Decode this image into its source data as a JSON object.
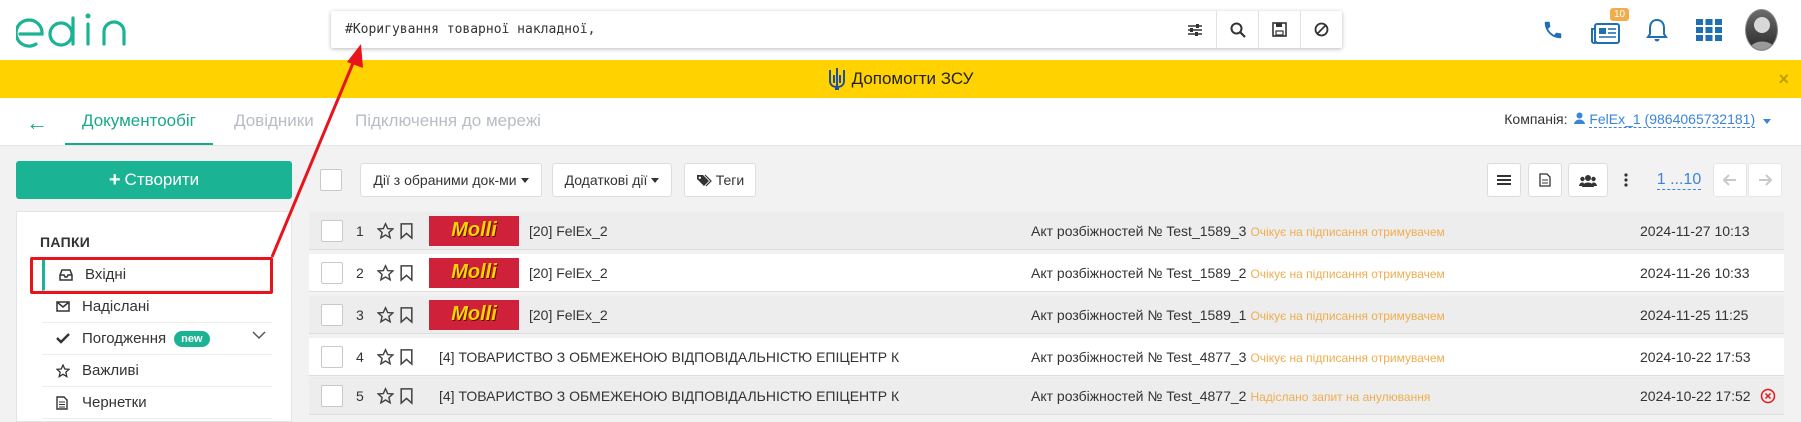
{
  "app": {
    "logo_text": "edin"
  },
  "search": {
    "value": "#Коригування товарної накладної,",
    "buttons": [
      "filter-sliders-icon",
      "search-icon",
      "save-icon",
      "clear-icon"
    ]
  },
  "top_icons": {
    "phone": "phone-icon",
    "news": "newspaper-icon",
    "news_badge": "10",
    "bell": "bell-icon",
    "apps": "apps-grid-icon"
  },
  "banner": {
    "text": "Допомогти ЗСУ",
    "close": "×"
  },
  "nav": {
    "back": "←",
    "tabs": [
      {
        "label": "Документообіг",
        "active": true
      },
      {
        "label": "Довідники",
        "active": false
      },
      {
        "label": "Підключення до мережі",
        "active": false
      }
    ],
    "company_label": "Компанія:",
    "company_value": "FelEx_1 (9864065732181)"
  },
  "sidebar": {
    "create_label": "Створити",
    "folders_title": "ПАПКИ",
    "folders": [
      {
        "label": "Вхідні",
        "icon": "inbox-icon",
        "active": true
      },
      {
        "label": "Надіслані",
        "icon": "envelope-icon"
      },
      {
        "label": "Погодження",
        "icon": "check-icon",
        "badge": "new"
      },
      {
        "label": "Важливі",
        "icon": "star-icon"
      },
      {
        "label": "Чернетки",
        "icon": "draft-icon"
      }
    ]
  },
  "toolbar": {
    "actions_label": "Дії з обраними док-ми",
    "extra_label": "Додаткові дії",
    "tags_label": "Теги",
    "pager": "1 ...10"
  },
  "rows": [
    {
      "num": "1",
      "logo": "Molli",
      "name": "[20] FelEx_2",
      "doc": "Акт розбіжностей № Test_1589_3",
      "status": "Очікує на підписання отримувачем",
      "date": "2024-11-27 10:13"
    },
    {
      "num": "2",
      "logo": "Molli",
      "name": "[20] FelEx_2",
      "doc": "Акт розбіжностей № Test_1589_2",
      "status": "Очікує на підписання отримувачем",
      "date": "2024-11-26 10:33"
    },
    {
      "num": "3",
      "logo": "Molli",
      "name": "[20] FelEx_2",
      "doc": "Акт розбіжностей № Test_1589_1",
      "status": "Очікує на підписання отримувачем",
      "date": "2024-11-25 11:25"
    },
    {
      "num": "4",
      "logo": "",
      "name": "[4] ТОВАРИСТВО З ОБМЕЖЕНОЮ ВІДПОВІДАЛЬНІСТЮ ЕПІЦЕНТР К",
      "doc": "Акт розбіжностей № Test_4877_3",
      "status": "Очікує на підписання отримувачем",
      "date": "2024-10-22 17:53"
    },
    {
      "num": "5",
      "logo": "",
      "name": "[4] ТОВАРИСТВО З ОБМЕЖЕНОЮ ВІДПОВІДАЛЬНІСТЮ ЕПІЦЕНТР К",
      "doc": "Акт розбіжностей № Test_4877_2",
      "status": "Надіслано запит на анулювання",
      "date": "2024-10-22 17:52"
    }
  ],
  "colors": {
    "brand": "#1ab394",
    "banner": "#ffd200",
    "status": "#f0ad4e",
    "annotation": "#e8141c",
    "link": "#3a84d9"
  }
}
